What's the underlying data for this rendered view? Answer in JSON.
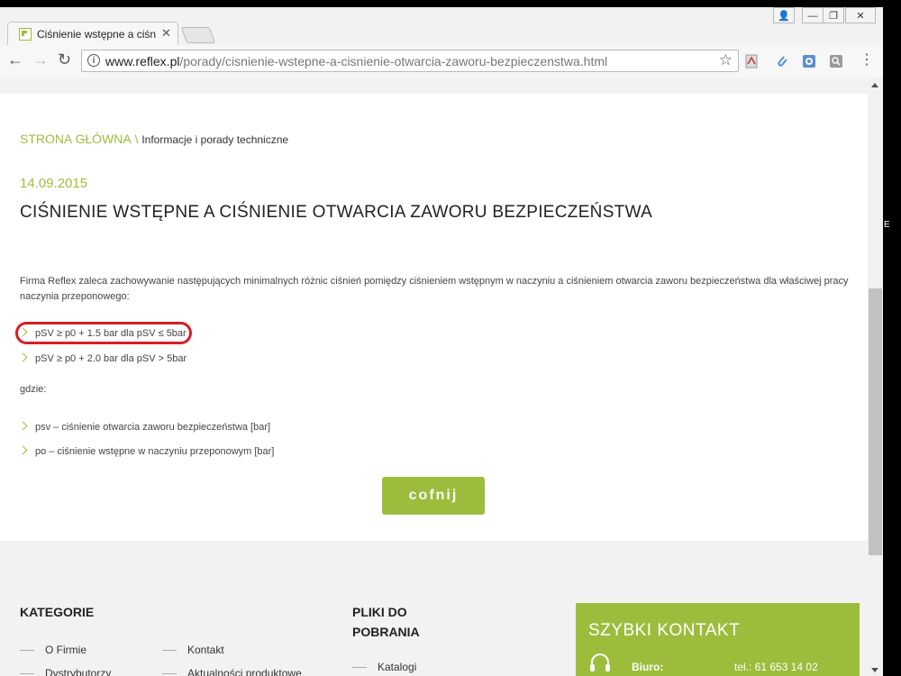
{
  "browser": {
    "tab_title": "Ciśnienie wstępne a ciśnie",
    "tab_close": "✕",
    "url_host": "www.reflex.pl",
    "url_path": "/porady/cisnienie-wstepne-a-cisnienie-otwarcia-zaworu-bezpieczenstwa.html",
    "win_user": "👤",
    "win_min": "—",
    "win_max": "❐",
    "win_close": "✕"
  },
  "breadcrumb": {
    "home": "STRONA GŁÓWNA",
    "separator": "\\",
    "current": "Informacje i porady techniczne"
  },
  "article": {
    "date": "14.09.2015",
    "title": "CIŚNIENIE WSTĘPNE A CIŚNIENIE OTWARCIA ZAWORU BEZPIECZEŃSTWA",
    "intro": "Firma Reflex zaleca zachowywanie następujących minimalnych różnic ciśnień pomiędzy ciśnieniem wstępnym w naczyniu a ciśnieniem otwarcia zaworu bezpieczeństwa dla właściwej pracy naczynia przeponowego:",
    "rules": [
      "pSV ≥ p0 + 1.5 bar dla pSV ≤ 5bar",
      "pSV ≥ p0 + 2.0 bar dla pSV > 5bar"
    ],
    "where_label": "gdzie:",
    "definitions": [
      "psv – ciśnienie otwarcia zaworu bezpieczeństwa [bar]",
      "po – ciśnienie wstępne w naczyniu przeponowym [bar]"
    ],
    "back_button": "cofnij"
  },
  "footer": {
    "categories_title": "KATEGORIE",
    "categories_col1": [
      "O Firmie",
      "Dystrybutorzy"
    ],
    "categories_col2": [
      "Kontakt",
      "Aktualności produktowe"
    ],
    "downloads_title_line1": "PLIKI DO",
    "downloads_title_line2": "POBRANIA",
    "downloads": [
      "Katalogi"
    ],
    "quick_contact": {
      "title": "SZYBKI KONTAKT",
      "label": "Biuro:",
      "value": "tel.: 61 653 14 02"
    }
  },
  "colors": {
    "accent": "#9cbd3c",
    "highlight": "#d41f26"
  }
}
